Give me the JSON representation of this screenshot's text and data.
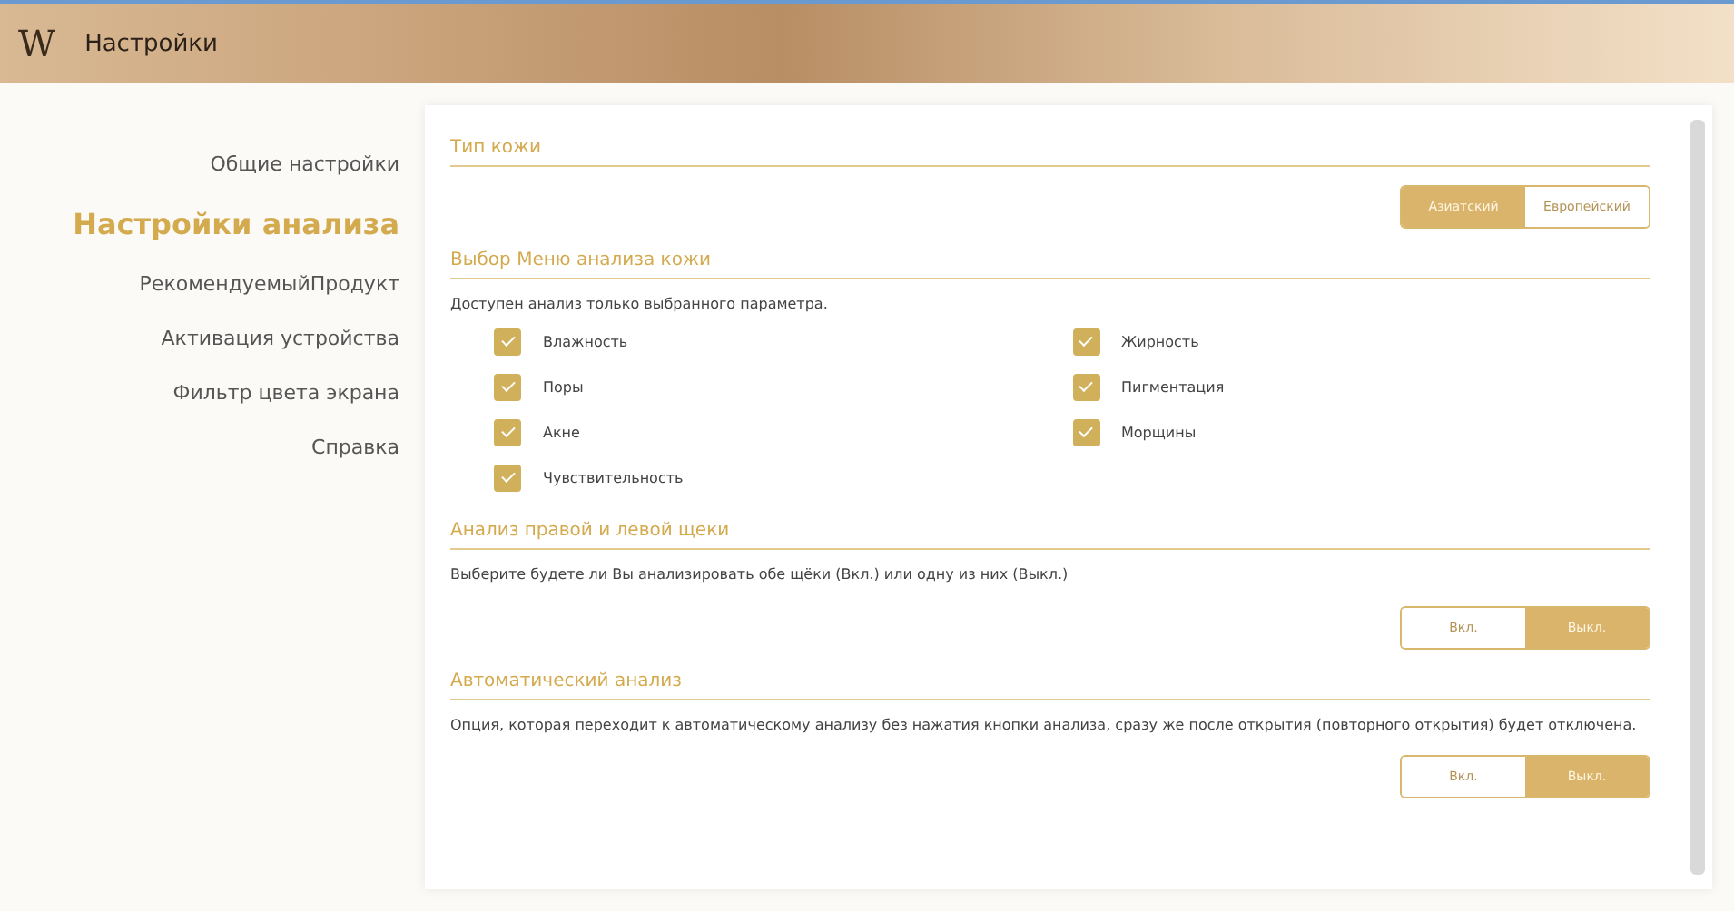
{
  "window": {
    "logo": "W",
    "title": "Настройки"
  },
  "sidebar": {
    "items": [
      {
        "label": "Общие настройки",
        "selected": false
      },
      {
        "label": "Настройки анализа",
        "selected": true
      },
      {
        "label": "РекомендуемыйПродукт",
        "selected": false
      },
      {
        "label": "Активация устройства",
        "selected": false
      },
      {
        "label": "Фильтр цвета экрана",
        "selected": false
      },
      {
        "label": "Справка",
        "selected": false
      }
    ]
  },
  "sections": [
    {
      "kind": "toggle",
      "title": "Тип кожи",
      "options": [
        {
          "label": "Азиатский",
          "selected": true
        },
        {
          "label": "Европейский",
          "selected": false
        }
      ]
    },
    {
      "kind": "checklist",
      "title": "Выбор Меню анализа кожи",
      "description": "Доступен анализ только выбранного параметра.",
      "items": [
        {
          "label": "Влажность",
          "checked": true
        },
        {
          "label": "Жирность",
          "checked": true
        },
        {
          "label": "Поры",
          "checked": true
        },
        {
          "label": "Пигментация",
          "checked": true
        },
        {
          "label": "Акне",
          "checked": true
        },
        {
          "label": "Морщины",
          "checked": true
        },
        {
          "label": "Чувствительность",
          "checked": true
        }
      ]
    },
    {
      "kind": "toggle",
      "title": "Анализ правой и левой щеки",
      "description": "Выберите будете ли Вы анализировать обе щёки (Вкл.) или одну из них (Выкл.)",
      "options": [
        {
          "label": "Вкл.",
          "selected": false
        },
        {
          "label": "Выкл.",
          "selected": true
        }
      ]
    },
    {
      "kind": "toggle",
      "title": "Автоматический анализ",
      "description": "Опция, которая переходит к автоматическому анализу без нажатия кнопки анализа, сразу же после открытия (повторного открытия) будет отключена.",
      "options": [
        {
          "label": "Вкл.",
          "selected": false
        },
        {
          "label": "Выкл.",
          "selected": true
        }
      ]
    }
  ]
}
